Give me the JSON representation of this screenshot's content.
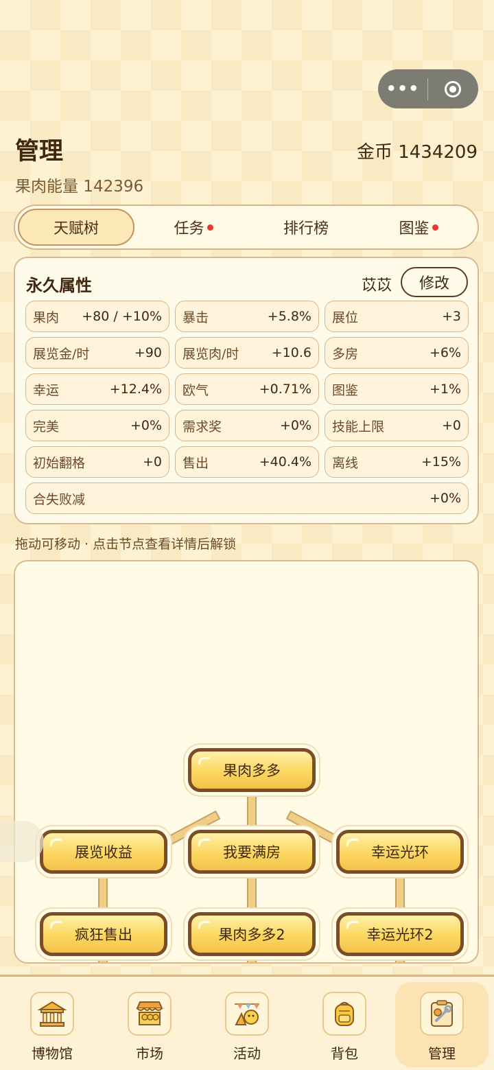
{
  "header": {
    "title": "管理",
    "coins": "金币 1434209",
    "energy": "果肉能量 142396"
  },
  "tabs": [
    {
      "label": "天赋树",
      "active": true,
      "dot": false
    },
    {
      "label": "任务",
      "active": false,
      "dot": true
    },
    {
      "label": "排行榜",
      "active": false,
      "dot": false
    },
    {
      "label": "图鉴",
      "active": false,
      "dot": true
    }
  ],
  "attributes": {
    "title": "永久属性",
    "nickname": "苡苡",
    "edit_label": "修改",
    "stats": [
      {
        "label": "果肉",
        "value": "+80 / +10%"
      },
      {
        "label": "暴击",
        "value": "+5.8%"
      },
      {
        "label": "展位",
        "value": "+3"
      },
      {
        "label": "展览金/时",
        "value": "+90"
      },
      {
        "label": "展览肉/时",
        "value": "+10.6"
      },
      {
        "label": "多房",
        "value": "+6%"
      },
      {
        "label": "幸运",
        "value": "+12.4%"
      },
      {
        "label": "欧气",
        "value": "+0.71%"
      },
      {
        "label": "图鉴",
        "value": "+1%"
      },
      {
        "label": "完美",
        "value": "+0%"
      },
      {
        "label": "需求奖",
        "value": "+0%"
      },
      {
        "label": "技能上限",
        "value": "+0"
      },
      {
        "label": "初始翻格",
        "value": "+0"
      },
      {
        "label": "售出",
        "value": "+40.4%"
      },
      {
        "label": "离线",
        "value": "+15%"
      },
      {
        "label": "合失败减",
        "value": "+0%"
      }
    ]
  },
  "hint": "拖动可移动 · 点击节点查看详情后解锁",
  "tree": {
    "nodes": [
      {
        "label": "果肉多多"
      },
      {
        "label": "展览收益"
      },
      {
        "label": "我要满房"
      },
      {
        "label": "幸运光环"
      },
      {
        "label": "疯狂售出"
      },
      {
        "label": "果肉多多2"
      },
      {
        "label": "幸运光环2"
      }
    ]
  },
  "nav": [
    {
      "label": "博物馆",
      "icon": "museum-icon",
      "active": false
    },
    {
      "label": "市场",
      "icon": "market-stall-icon",
      "active": false
    },
    {
      "label": "活动",
      "icon": "party-icon",
      "active": false
    },
    {
      "label": "背包",
      "icon": "backpack-icon",
      "active": false
    },
    {
      "label": "管理",
      "icon": "manage-tools-icon",
      "active": true
    }
  ],
  "colors": {
    "accent_red": "#e43a2f",
    "node_border": "#7a4d26",
    "node_fill": "#fbd760"
  }
}
